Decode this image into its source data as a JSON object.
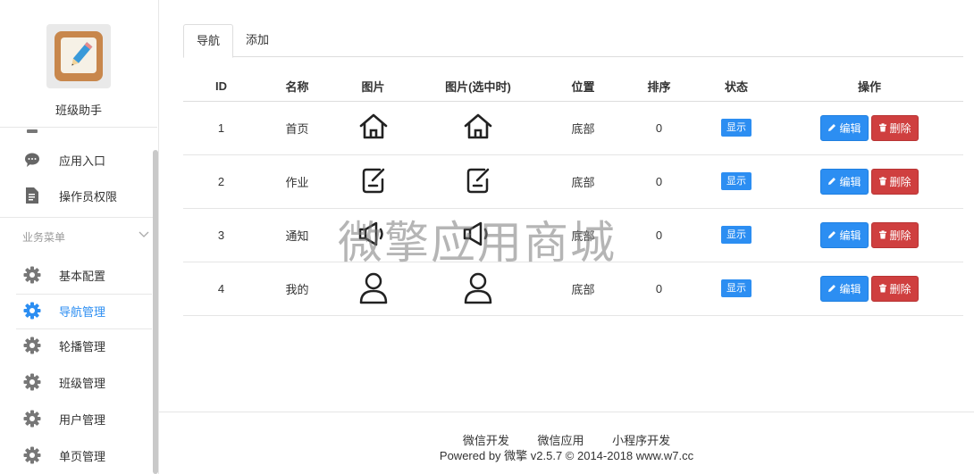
{
  "sidebar": {
    "app_name": "班级助手",
    "items_top": [
      {
        "label": "应用入口",
        "icon": "chat-icon"
      },
      {
        "label": "操作员权限",
        "icon": "document-icon"
      }
    ],
    "section_title": "业务菜单",
    "items": [
      {
        "label": "基本配置",
        "icon": "gear-icon"
      },
      {
        "label": "导航管理",
        "icon": "gear-icon",
        "active": true
      },
      {
        "label": "轮播管理",
        "icon": "gear-icon"
      },
      {
        "label": "班级管理",
        "icon": "gear-icon"
      },
      {
        "label": "用户管理",
        "icon": "gear-icon"
      },
      {
        "label": "单页管理",
        "icon": "gear-icon"
      }
    ]
  },
  "tabs": [
    {
      "label": "导航",
      "active": true
    },
    {
      "label": "添加",
      "active": false
    }
  ],
  "table": {
    "headers": [
      "ID",
      "名称",
      "图片",
      "图片(选中时)",
      "位置",
      "排序",
      "状态",
      "操作"
    ],
    "rows": [
      {
        "id": "1",
        "name": "首页",
        "icon": "home-icon",
        "position": "底部",
        "sort": "0",
        "status": "显示"
      },
      {
        "id": "2",
        "name": "作业",
        "icon": "edit-note-icon",
        "position": "底部",
        "sort": "0",
        "status": "显示"
      },
      {
        "id": "3",
        "name": "通知",
        "icon": "speaker-icon",
        "position": "底部",
        "sort": "0",
        "status": "显示"
      },
      {
        "id": "4",
        "name": "我的",
        "icon": "user-icon",
        "position": "底部",
        "sort": "0",
        "status": "显示"
      }
    ],
    "edit_label": "编辑",
    "delete_label": "删除"
  },
  "watermark": "微擎应用商城",
  "footer": {
    "links": [
      "微信开发",
      "微信应用",
      "小程序开发"
    ],
    "copyright": "Powered by 微擎 v2.5.7 © 2014-2018 www.w7.cc"
  },
  "colors": {
    "accent": "#2c8ef2",
    "danger": "#cf3f3f"
  }
}
